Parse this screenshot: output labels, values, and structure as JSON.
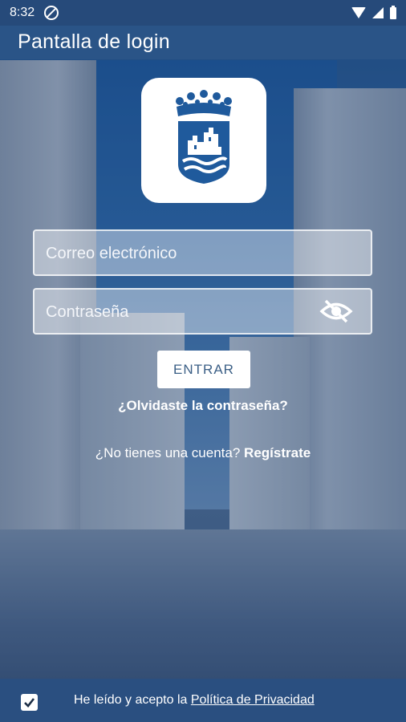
{
  "status_bar": {
    "time": "8:32"
  },
  "app_bar": {
    "title": "Pantalla de login"
  },
  "form": {
    "email_placeholder": "Correo electrónico",
    "password_placeholder": "Contraseña",
    "submit_label": "ENTRAR",
    "forgot_label": "¿Olvidaste la contraseña?",
    "no_account_text": "¿No tienes una cuenta?",
    "register_link": "Regístrate"
  },
  "footer": {
    "policy_prefix": "He leído y acepto la",
    "policy_link": "Política de Privacidad",
    "checkbox_checked": true
  },
  "colors": {
    "primary": "#2a5487",
    "logo_blue": "#1f5a9c"
  },
  "icons": {
    "password_toggle": "eye-off-icon",
    "status": [
      "do-not-disturb-icon",
      "wifi-icon",
      "signal-icon",
      "battery-icon"
    ]
  }
}
